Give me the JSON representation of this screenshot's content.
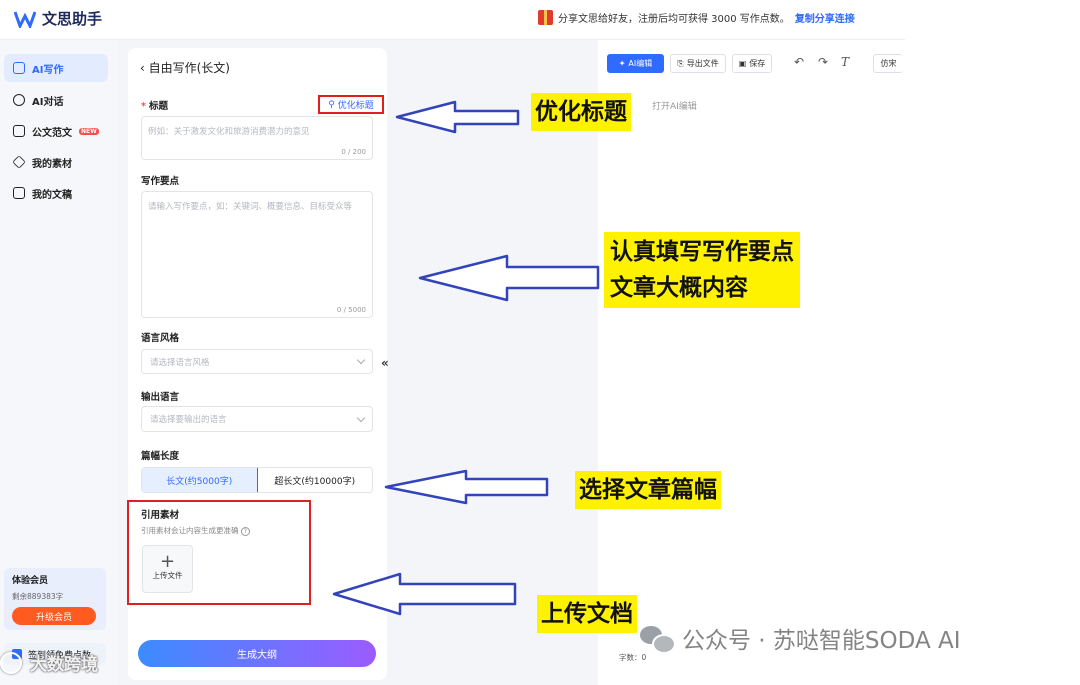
{
  "app": {
    "title": "文思助手"
  },
  "share": {
    "text": "分享文思给好友，注册后均可获得 3000 写作点数。",
    "link": "复制分享连接"
  },
  "sidebar": {
    "items": [
      {
        "label": "AI写作",
        "icon": "pen-doc-icon"
      },
      {
        "label": "AI对话",
        "icon": "chat-bubble-icon"
      },
      {
        "label": "公文范文",
        "icon": "template-icon",
        "badge": "NEW"
      },
      {
        "label": "我的素材",
        "icon": "layers-icon"
      },
      {
        "label": "我的文稿",
        "icon": "document-icon"
      }
    ],
    "member": {
      "title": "体验会员",
      "remaining": "剩余889383字",
      "upgrade": "升级会员"
    },
    "sign_in": "签到领免费点数"
  },
  "form": {
    "back_title": "自由写作(长文)",
    "title_label": "标题",
    "optimize_button": "优化标题",
    "title_placeholder": "例如：关于激发文化和旅游消费潜力的意见",
    "title_count": "0 / 200",
    "points_label": "写作要点",
    "points_placeholder": "请输入写作要点，如：关键词、概要信息、目标受众等",
    "points_count": "0 / 5000",
    "style_label": "语言风格",
    "style_placeholder": "请选择语言风格",
    "output_label": "输出语言",
    "output_placeholder": "请选择要输出的语言",
    "length_label": "篇幅长度",
    "length_options": [
      "长文(约5000字)",
      "超长文(约10000字)"
    ],
    "ref_label": "引用素材",
    "ref_hint": "引用素材会让内容生成更准确",
    "upload_label": "上传文件",
    "generate_button": "生成大纲"
  },
  "editor": {
    "ai_edit": "AI编辑",
    "export": "导出文件",
    "save": "保存",
    "font": "仿宋",
    "hint": "打开AI编辑",
    "word_count": "字数：0"
  },
  "annotations": {
    "optimize_title": "优化标题",
    "fill_points_1": "认真填写写作要点",
    "fill_points_2": "文章大概内容",
    "choose_length": "选择文章篇幅",
    "upload_doc": "上传文档"
  },
  "watermarks": {
    "right": "公众号 · 苏哒智能SODA AI",
    "left": "大数跨境"
  },
  "colors": {
    "accent": "#2f6bff",
    "highlight": "#fff200",
    "red_box": "#e02020",
    "arrow": "#3344bb"
  }
}
